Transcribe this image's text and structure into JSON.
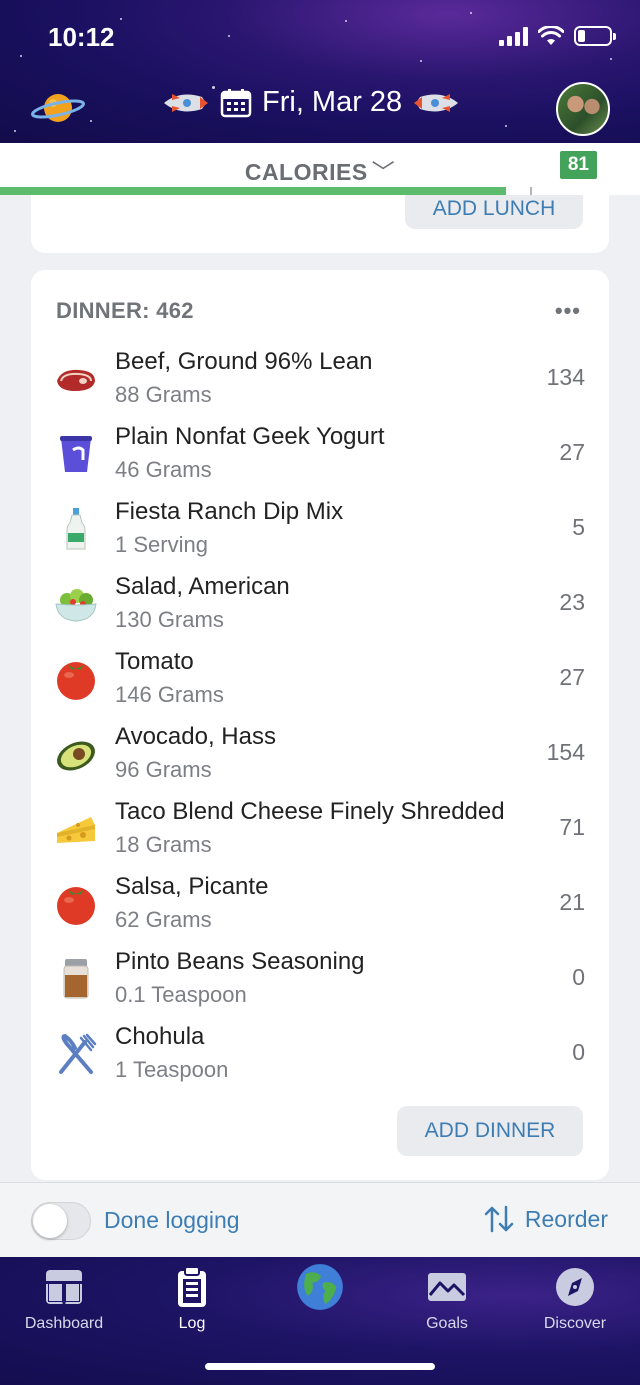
{
  "status_bar": {
    "time": "10:12"
  },
  "header": {
    "date_label": "Fri, Mar 28"
  },
  "calories_bar": {
    "title": "CALORIES",
    "badge": "81",
    "progress_fraction": 0.79
  },
  "lunch": {
    "add_button": "ADD LUNCH"
  },
  "dinner": {
    "header": "DINNER: 462",
    "more": "•••",
    "items": [
      {
        "name": "Beef, Ground 96% Lean",
        "amount": "88 Grams",
        "calories": "134",
        "icon": "steak-icon"
      },
      {
        "name": "Plain Nonfat Geek Yogurt",
        "amount": "46 Grams",
        "calories": "27",
        "icon": "yogurt-cup-icon"
      },
      {
        "name": "Fiesta Ranch Dip Mix",
        "amount": "1 Serving",
        "calories": "5",
        "icon": "dressing-bottle-icon"
      },
      {
        "name": "Salad, American",
        "amount": "130 Grams",
        "calories": "23",
        "icon": "salad-bowl-icon"
      },
      {
        "name": "Tomato",
        "amount": "146 Grams",
        "calories": "27",
        "icon": "tomato-icon"
      },
      {
        "name": "Avocado, Hass",
        "amount": "96 Grams",
        "calories": "154",
        "icon": "avocado-icon"
      },
      {
        "name": "Taco Blend Cheese Finely Shredded",
        "amount": "18 Grams",
        "calories": "71",
        "icon": "cheese-icon"
      },
      {
        "name": "Salsa, Picante",
        "amount": "62 Grams",
        "calories": "21",
        "icon": "tomato-icon"
      },
      {
        "name": "Pinto Beans Seasoning",
        "amount": "0.1 Teaspoon",
        "calories": "0",
        "icon": "spice-jar-icon"
      },
      {
        "name": "Chohula",
        "amount": "1 Teaspoon",
        "calories": "0",
        "icon": "fork-knife-icon"
      }
    ],
    "add_button": "ADD DINNER"
  },
  "footer": {
    "done_label": "Done logging",
    "reorder_label": "Reorder",
    "done_toggle_on": false
  },
  "tabs": [
    {
      "label": "Dashboard",
      "icon": "dashboard-icon"
    },
    {
      "label": "Log",
      "icon": "clipboard-icon"
    },
    {
      "label": "",
      "icon": "globe-icon"
    },
    {
      "label": "Goals",
      "icon": "envelope-chart-icon"
    },
    {
      "label": "Discover",
      "icon": "compass-icon"
    }
  ],
  "colors": {
    "accent": "#3e7db3",
    "progress": "#5dbb6e",
    "badge": "#44a35a",
    "space": "#1a1060"
  }
}
